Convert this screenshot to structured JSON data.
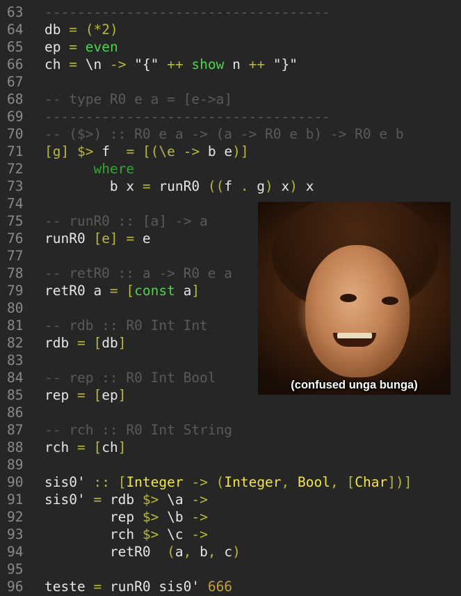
{
  "editor": {
    "lines": [
      {
        "n": "63",
        "t": [
          [
            "c",
            "-----------------------------------"
          ]
        ]
      },
      {
        "n": "64",
        "t": [
          [
            "d",
            "db "
          ],
          [
            "o",
            "="
          ],
          [
            "d",
            " "
          ],
          [
            "o",
            "(*2)"
          ]
        ]
      },
      {
        "n": "65",
        "t": [
          [
            "d",
            "ep "
          ],
          [
            "o",
            "="
          ],
          [
            "d",
            " "
          ],
          [
            "k",
            "even"
          ]
        ]
      },
      {
        "n": "66",
        "t": [
          [
            "d",
            "ch "
          ],
          [
            "o",
            "="
          ],
          [
            "d",
            " \\n "
          ],
          [
            "o",
            "->"
          ],
          [
            "d",
            " \"{\" "
          ],
          [
            "o",
            "++"
          ],
          [
            "d",
            " "
          ],
          [
            "k",
            "show"
          ],
          [
            "d",
            " n "
          ],
          [
            "o",
            "++"
          ],
          [
            "d",
            " \"}\""
          ]
        ]
      },
      {
        "n": "67",
        "t": []
      },
      {
        "n": "68",
        "t": [
          [
            "c",
            "-- type R0 e a = [e->a]"
          ]
        ]
      },
      {
        "n": "69",
        "t": [
          [
            "c",
            "-----------------------------------"
          ]
        ]
      },
      {
        "n": "70",
        "t": [
          [
            "c",
            "-- ($>) :: R0 e a -> (a -> R0 e b) -> R0 e b"
          ]
        ]
      },
      {
        "n": "71",
        "t": [
          [
            "o",
            "[g]"
          ],
          [
            "d",
            " "
          ],
          [
            "o",
            "$>"
          ],
          [
            "d",
            " f  "
          ],
          [
            "o",
            "="
          ],
          [
            "d",
            " "
          ],
          [
            "o",
            "[(\\e ->"
          ],
          [
            "d",
            " b e"
          ],
          [
            "o",
            ")]"
          ]
        ]
      },
      {
        "n": "72",
        "t": [
          [
            "d",
            "      "
          ],
          [
            "w",
            "where"
          ]
        ]
      },
      {
        "n": "73",
        "t": [
          [
            "d",
            "        b x "
          ],
          [
            "o",
            "="
          ],
          [
            "d",
            " runR0 "
          ],
          [
            "o",
            "(("
          ],
          [
            "d",
            "f "
          ],
          [
            "o",
            "."
          ],
          [
            "d",
            " g"
          ],
          [
            "o",
            ")"
          ],
          [
            "d",
            " x"
          ],
          [
            "o",
            ")"
          ],
          [
            "d",
            " x"
          ]
        ]
      },
      {
        "n": "74",
        "t": []
      },
      {
        "n": "75",
        "t": [
          [
            "c",
            "-- runR0 :: [a] -> a"
          ]
        ]
      },
      {
        "n": "76",
        "t": [
          [
            "d",
            "runR0 "
          ],
          [
            "o",
            "[e]"
          ],
          [
            "d",
            " "
          ],
          [
            "o",
            "="
          ],
          [
            "d",
            " e"
          ]
        ]
      },
      {
        "n": "77",
        "t": []
      },
      {
        "n": "78",
        "t": [
          [
            "c",
            "-- retR0 :: a -> R0 e a"
          ]
        ]
      },
      {
        "n": "79",
        "t": [
          [
            "d",
            "retR0 a "
          ],
          [
            "o",
            "="
          ],
          [
            "d",
            " "
          ],
          [
            "o",
            "["
          ],
          [
            "k",
            "const"
          ],
          [
            "d",
            " a"
          ],
          [
            "o",
            "]"
          ]
        ]
      },
      {
        "n": "80",
        "t": []
      },
      {
        "n": "81",
        "t": [
          [
            "c",
            "-- rdb :: R0 Int Int"
          ]
        ]
      },
      {
        "n": "82",
        "t": [
          [
            "d",
            "rdb "
          ],
          [
            "o",
            "="
          ],
          [
            "d",
            " "
          ],
          [
            "o",
            "["
          ],
          [
            "d",
            "db"
          ],
          [
            "o",
            "]"
          ]
        ]
      },
      {
        "n": "83",
        "t": []
      },
      {
        "n": "84",
        "t": [
          [
            "c",
            "-- rep :: R0 Int Bool"
          ]
        ]
      },
      {
        "n": "85",
        "t": [
          [
            "d",
            "rep "
          ],
          [
            "o",
            "="
          ],
          [
            "d",
            " "
          ],
          [
            "o",
            "["
          ],
          [
            "d",
            "ep"
          ],
          [
            "o",
            "]"
          ]
        ]
      },
      {
        "n": "86",
        "t": []
      },
      {
        "n": "87",
        "t": [
          [
            "c",
            "-- rch :: R0 Int String"
          ]
        ]
      },
      {
        "n": "88",
        "t": [
          [
            "d",
            "rch "
          ],
          [
            "o",
            "="
          ],
          [
            "d",
            " "
          ],
          [
            "o",
            "["
          ],
          [
            "d",
            "ch"
          ],
          [
            "o",
            "]"
          ]
        ]
      },
      {
        "n": "89",
        "t": []
      },
      {
        "n": "90",
        "t": [
          [
            "d",
            "sis0' "
          ],
          [
            "o",
            "::"
          ],
          [
            "d",
            " "
          ],
          [
            "o",
            "["
          ],
          [
            "y",
            "Integer"
          ],
          [
            "d",
            " "
          ],
          [
            "o",
            "->"
          ],
          [
            "d",
            " "
          ],
          [
            "o",
            "("
          ],
          [
            "y",
            "Integer"
          ],
          [
            "o",
            ","
          ],
          [
            "d",
            " "
          ],
          [
            "y",
            "Bool"
          ],
          [
            "o",
            ","
          ],
          [
            "d",
            " "
          ],
          [
            "o",
            "["
          ],
          [
            "y",
            "Char"
          ],
          [
            "o",
            "])]"
          ]
        ]
      },
      {
        "n": "91",
        "t": [
          [
            "d",
            "sis0' "
          ],
          [
            "o",
            "="
          ],
          [
            "d",
            " rdb "
          ],
          [
            "o",
            "$>"
          ],
          [
            "d",
            " \\a "
          ],
          [
            "o",
            "->"
          ]
        ]
      },
      {
        "n": "92",
        "t": [
          [
            "d",
            "        rep "
          ],
          [
            "o",
            "$>"
          ],
          [
            "d",
            " \\b "
          ],
          [
            "o",
            "->"
          ]
        ]
      },
      {
        "n": "93",
        "t": [
          [
            "d",
            "        rch "
          ],
          [
            "o",
            "$>"
          ],
          [
            "d",
            " \\c "
          ],
          [
            "o",
            "->"
          ]
        ]
      },
      {
        "n": "94",
        "t": [
          [
            "d",
            "        retR0  "
          ],
          [
            "o",
            "("
          ],
          [
            "d",
            "a"
          ],
          [
            "o",
            ","
          ],
          [
            "d",
            " b"
          ],
          [
            "o",
            ","
          ],
          [
            "d",
            " c"
          ],
          [
            "o",
            ")"
          ]
        ]
      },
      {
        "n": "95",
        "t": []
      },
      {
        "n": "96",
        "t": [
          [
            "d",
            "teste "
          ],
          [
            "o",
            "="
          ],
          [
            "d",
            " runR0 sis0' "
          ],
          [
            "n",
            "666"
          ]
        ]
      }
    ]
  },
  "meme": {
    "caption": "(confused unga bunga)"
  },
  "colors": {
    "background": "#262626",
    "line_number": "#8a8a8a",
    "comment": "#5a5a5a",
    "operator": "#b8b83a",
    "keyword": "#4ad64a",
    "type": "#f2e54a",
    "number": "#c0a040",
    "text": "#e6e6e6"
  }
}
